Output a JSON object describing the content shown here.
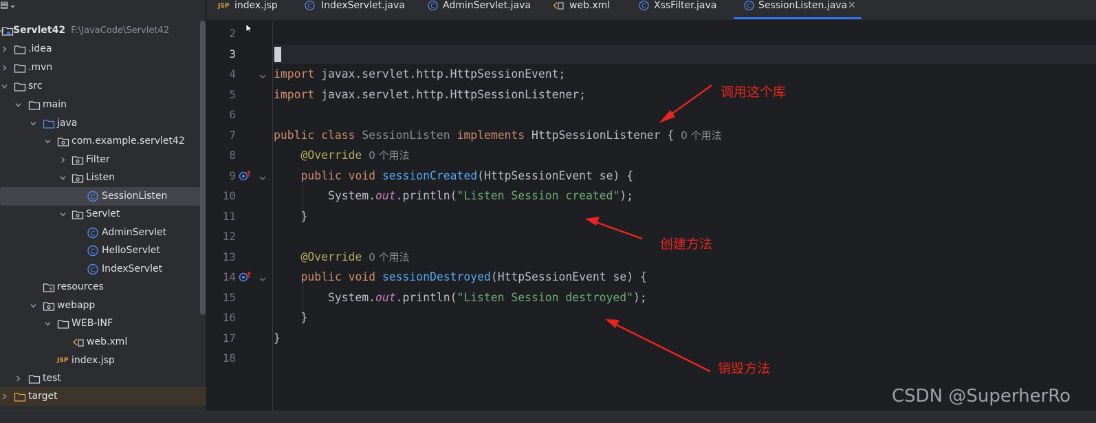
{
  "project": {
    "root_name": "Servlet42",
    "root_path": "F:\\JavaCode\\Servlet42",
    "items": [
      {
        "label": "Servlet42"
      },
      {
        "label": ".idea"
      },
      {
        "label": ".mvn"
      },
      {
        "label": "src"
      },
      {
        "label": "main"
      },
      {
        "label": "java"
      },
      {
        "label": "com.example.servlet42"
      },
      {
        "label": "Filter"
      },
      {
        "label": "Listen"
      },
      {
        "label": "SessionListen"
      },
      {
        "label": "Servlet"
      },
      {
        "label": "AdminServlet"
      },
      {
        "label": "HelloServlet"
      },
      {
        "label": "IndexServlet"
      },
      {
        "label": "resources"
      },
      {
        "label": "webapp"
      },
      {
        "label": "WEB-INF"
      },
      {
        "label": "web.xml"
      },
      {
        "label": "index.jsp"
      },
      {
        "label": "test"
      },
      {
        "label": "target"
      }
    ]
  },
  "tabs": [
    {
      "label": "index.jsp",
      "icon": "jsp-file-icon"
    },
    {
      "label": "IndexServlet.java",
      "icon": "class-icon"
    },
    {
      "label": "AdminServlet.java",
      "icon": "class-icon"
    },
    {
      "label": "web.xml",
      "icon": "xml-file-icon"
    },
    {
      "label": "XssFilter.java",
      "icon": "class-icon"
    },
    {
      "label": "SessionListen.java",
      "icon": "class-icon",
      "active": true
    }
  ],
  "editor": {
    "line_numbers": [
      "2",
      "3",
      "4",
      "5",
      "6",
      "7",
      "8",
      "9",
      "10",
      "11",
      "12",
      "13",
      "14",
      "15",
      "16",
      "17",
      "18"
    ],
    "current_line": "3",
    "usage_hint": "0 个用法",
    "code": {
      "l4_kw": "import",
      "l4_rest": " javax.servlet.http.HttpSessionEvent;",
      "l5_kw": "import",
      "l5_rest": " javax.servlet.http.HttpSessionListener;",
      "l7_public": "public",
      "l7_class": "class",
      "l7_name": "SessionListen",
      "l7_impl": "implements",
      "l7_iface": "HttpSessionListener {",
      "override": "@Override",
      "l9_public": "public",
      "l9_void": "void",
      "l9_method": "sessionCreated",
      "l9_params": "(HttpSessionEvent se) {",
      "l10_sys": "System.",
      "l10_out": "out",
      "l10_print": ".println(",
      "l10_str": "\"Listen Session created\"",
      "l10_end": ");",
      "close_brace": "}",
      "l14_method": "sessionDestroyed",
      "l15_str": "\"Listen Session destroyed\""
    }
  },
  "annotations": {
    "library": "调用这个库",
    "create": "创建方法",
    "destroy": "销毁方法",
    "color": "#e8261f"
  },
  "watermark": "CSDN @SuperherRo",
  "colors": {
    "keyword": "#cf8e6d",
    "annotation": "#b3ae60",
    "method": "#56a8f5",
    "string": "#6aab73",
    "field": "#c77dbb",
    "accent": "#3574f0"
  }
}
